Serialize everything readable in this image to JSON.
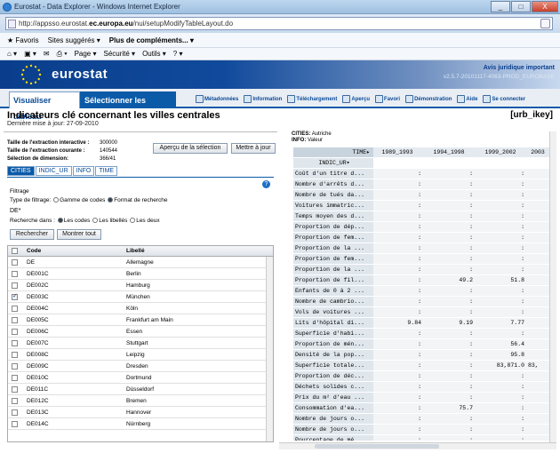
{
  "window": {
    "title": "Eurostat - Data Explorer - Windows Internet Explorer",
    "controls": [
      "_",
      "□",
      "X"
    ]
  },
  "address": {
    "prefix": "http://appsso.eurostat.",
    "domain": "ec.europa.eu",
    "suffix": "/nui/setupModifyTableLayout.do"
  },
  "favbar": {
    "favoris": "Favoris",
    "suggested": "Sites suggérés ▾",
    "more": "Plus de compléments... ▾"
  },
  "cmdbar": {
    "page": "Page ▾",
    "security": "Sécurité ▾",
    "tools": "Outils ▾"
  },
  "banner": {
    "logo": "eurostat",
    "legal": "Avis juridique important",
    "version": "v2.5.7-20101117-4063-PROD_EUROBASE"
  },
  "nav": {
    "tab_view": "Visualiser tableau",
    "tab_select": "Sélectionner les données",
    "tools": [
      "Métadonnées",
      "Information",
      "Téléchargement",
      "Aperçu",
      "Favori",
      "Démonstration",
      "Aide",
      "Se connecter"
    ]
  },
  "page": {
    "title": "Indicateurs clé concernant les villes centrales",
    "updated": "Dernière mise à jour: 27-09-2010",
    "code": "[urb_ikey]"
  },
  "meta": {
    "k1": "Taille de l'extraction interactive :",
    "v1": "300000",
    "k2": "Taille de l'extraction courante :",
    "v2": "140544",
    "k3": "Sélection de dimension:",
    "v3": "366/41"
  },
  "buttons": {
    "preview": "Aperçu de la sélection",
    "update": "Mettre à jour",
    "search": "Rechercher",
    "showall": "Montrer tout"
  },
  "subtabs": [
    "CITIES",
    "INDIC_UR",
    "INFO",
    "TIME"
  ],
  "filter": {
    "title": "Filtrage",
    "type_label": "Type de filtrage:",
    "opt_range": "Gamme de codes",
    "opt_pattern": "Format de recherche",
    "input": "DE*",
    "search_in": "Recherche dans :",
    "opt_codes": "Les codes",
    "opt_labels": "Les libellés",
    "opt_both": "Les deux"
  },
  "grid": {
    "col_code": "Code",
    "col_label": "Libellé",
    "rows": [
      {
        "code": "DE",
        "label": "Allemagne",
        "checked": false
      },
      {
        "code": "DE001C",
        "label": "Berlin",
        "checked": false
      },
      {
        "code": "DE002C",
        "label": "Hamburg",
        "checked": false
      },
      {
        "code": "DE003C",
        "label": "München",
        "checked": true
      },
      {
        "code": "DE004C",
        "label": "Köln",
        "checked": false
      },
      {
        "code": "DE005C",
        "label": "Frankfurt am Main",
        "checked": false
      },
      {
        "code": "DE006C",
        "label": "Essen",
        "checked": false
      },
      {
        "code": "DE007C",
        "label": "Stuttgart",
        "checked": false
      },
      {
        "code": "DE008C",
        "label": "Leipzig",
        "checked": false
      },
      {
        "code": "DE009C",
        "label": "Dresden",
        "checked": false
      },
      {
        "code": "DE010C",
        "label": "Dortmund",
        "checked": false
      },
      {
        "code": "DE011C",
        "label": "Düsseldorf",
        "checked": false
      },
      {
        "code": "DE012C",
        "label": "Bremen",
        "checked": false
      },
      {
        "code": "DE013C",
        "label": "Hannover",
        "checked": false
      },
      {
        "code": "DE014C",
        "label": "Nürnberg",
        "checked": false
      }
    ]
  },
  "preview": {
    "cities_label": "CITIES:",
    "cities_value": "Autriche",
    "info_label": "INFO:",
    "info_value": "Valeur",
    "time_label": "TIME▸",
    "indic_label": "INDIC_UR▾",
    "periods": [
      "1989_1993",
      "1994_1998",
      "1999_2002",
      "2003"
    ],
    "rows": [
      {
        "label": "Coût d'un titre d...",
        "vals": [
          ":",
          ":",
          ":",
          ""
        ]
      },
      {
        "label": "Nombre d'arrêts d...",
        "vals": [
          ":",
          ":",
          ":",
          ""
        ]
      },
      {
        "label": "Nombre de tués da...",
        "vals": [
          ":",
          ":",
          ":",
          ""
        ]
      },
      {
        "label": "Voitures immatric...",
        "vals": [
          ":",
          ":",
          ":",
          ""
        ]
      },
      {
        "label": "Temps moyen des d...",
        "vals": [
          ":",
          ":",
          ":",
          ""
        ]
      },
      {
        "label": "Proportion de dép...",
        "vals": [
          ":",
          ":",
          ":",
          ""
        ]
      },
      {
        "label": "Proportion de fem...",
        "vals": [
          ":",
          ":",
          ":",
          ""
        ]
      },
      {
        "label": "Proportion de la ...",
        "vals": [
          ":",
          ":",
          ":",
          ""
        ]
      },
      {
        "label": "Proportion de fem...",
        "vals": [
          ":",
          ":",
          ":",
          ""
        ]
      },
      {
        "label": "Proportion de la ...",
        "vals": [
          ":",
          ":",
          ":",
          ""
        ]
      },
      {
        "label": "Proportion de fil...",
        "vals": [
          ":",
          "49.2",
          "51.8",
          ""
        ]
      },
      {
        "label": "Enfants de 0 à 2 ...",
        "vals": [
          ":",
          ":",
          ":",
          ""
        ]
      },
      {
        "label": "Nombre de cambrio...",
        "vals": [
          ":",
          ":",
          ":",
          ""
        ]
      },
      {
        "label": "Vols de voitures ...",
        "vals": [
          ":",
          ":",
          ":",
          ""
        ]
      },
      {
        "label": "Lits d'hôpital di...",
        "vals": [
          "9.84",
          "9.19",
          "7.77",
          ""
        ]
      },
      {
        "label": "Superficie d'habi...",
        "vals": [
          ":",
          ":",
          ":",
          ""
        ]
      },
      {
        "label": "Proportion de mén...",
        "vals": [
          ":",
          ":",
          "56.4",
          ""
        ]
      },
      {
        "label": "Densité de la pop...",
        "vals": [
          ":",
          ":",
          "95.8",
          ""
        ]
      },
      {
        "label": "Superficie totale...",
        "vals": [
          ":",
          ":",
          "83,871.0",
          "83,"
        ]
      },
      {
        "label": "Proportion de déc...",
        "vals": [
          ":",
          ":",
          ":",
          ""
        ]
      },
      {
        "label": "Déchets solides c...",
        "vals": [
          ":",
          ":",
          ":",
          ""
        ]
      },
      {
        "label": "Prix du m² d'eau ...",
        "vals": [
          ":",
          ":",
          ":",
          ""
        ]
      },
      {
        "label": "Consommation d'ea...",
        "vals": [
          ":",
          "75.7",
          ":",
          ""
        ]
      },
      {
        "label": "Nombre de jours o...",
        "vals": [
          ":",
          ":",
          ":",
          ""
        ]
      },
      {
        "label": "Nombre de jours o...",
        "vals": [
          ":",
          ":",
          ":",
          ""
        ]
      },
      {
        "label": "Pourcentage de mé...",
        "vals": [
          ":",
          ":",
          ":",
          ""
        ]
      },
      {
        "label": "Proportion de tra...",
        "vals": [
          "14.0",
          "14.0",
          "16.3",
          ""
        ]
      },
      {
        "label": "Ratio des personn...",
        "vals": [
          "0.8",
          "0.7",
          "0.7",
          ""
        ]
      }
    ]
  }
}
